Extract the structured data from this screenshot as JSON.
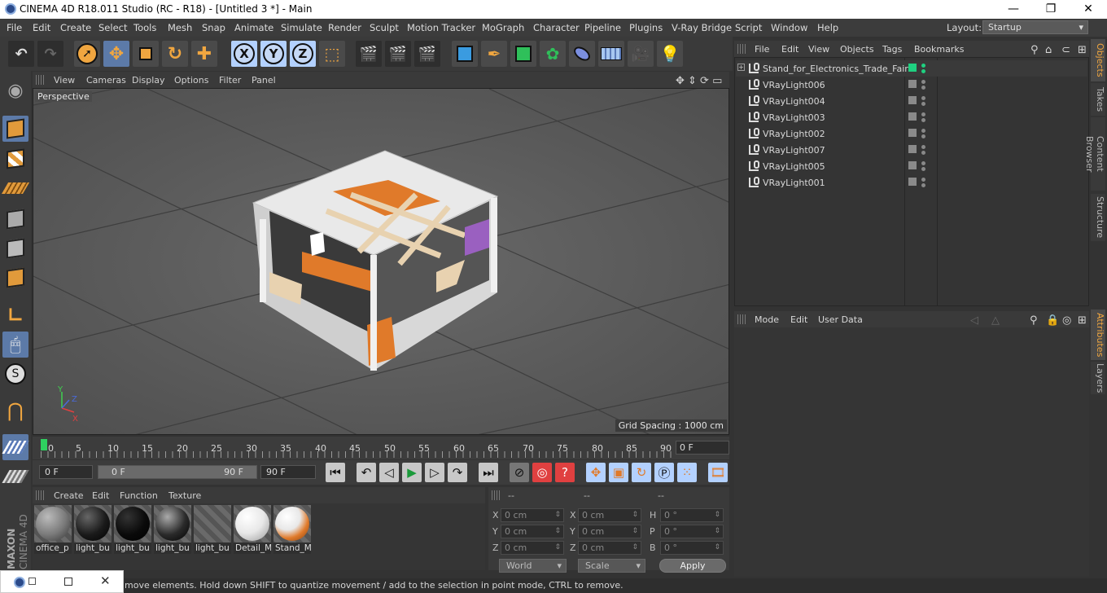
{
  "window": {
    "title": "CINEMA 4D R18.011 Studio (RC - R18) - [Untitled 3 *] - Main",
    "controls": [
      "—",
      "❐",
      "✕"
    ]
  },
  "menubar": {
    "items": [
      "File",
      "Edit",
      "Create",
      "Select",
      "Tools",
      "Mesh",
      "Snap",
      "Animate",
      "Simulate",
      "Render",
      "Sculpt",
      "Motion Tracker",
      "MoGraph",
      "Character",
      "Pipeline",
      "Plugins",
      "V-Ray Bridge",
      "Script",
      "Window",
      "Help"
    ],
    "layout_label": "Layout:",
    "layout_value": "Startup"
  },
  "toolbar": {
    "axis_x": "X",
    "axis_y": "Y",
    "axis_z": "Z"
  },
  "viewport": {
    "menu": [
      "View",
      "Cameras",
      "Display",
      "Options",
      "Filter",
      "Panel"
    ],
    "camera_label": "Perspective",
    "grid_spacing": "Grid Spacing : 1000 cm",
    "axis_labels": {
      "x": "X",
      "y": "Y",
      "z": "Z"
    }
  },
  "timeline": {
    "ticks": [
      "0",
      "5",
      "10",
      "15",
      "20",
      "25",
      "30",
      "35",
      "40",
      "45",
      "50",
      "55",
      "60",
      "65",
      "70",
      "75",
      "80",
      "85",
      "90"
    ],
    "current_frame": "0 F",
    "start_field": "0 F",
    "range_start": "0 F",
    "range_end": "90 F",
    "end_field": "90 F"
  },
  "materials": {
    "menu": [
      "Create",
      "Edit",
      "Function",
      "Texture"
    ],
    "items": [
      {
        "label": "office_p",
        "color": "#7a7a7a"
      },
      {
        "label": "light_bu",
        "color": "#1a1a1a"
      },
      {
        "label": "light_bu",
        "color": "#0a0a0a"
      },
      {
        "label": "light_bu",
        "color": "#2a2a2a"
      },
      {
        "label": "light_bu",
        "color": ""
      },
      {
        "label": "Detail_M",
        "color": "#e8e8e8"
      },
      {
        "label": "Stand_M",
        "color": "#e07a2a"
      }
    ]
  },
  "coordinates": {
    "headers": [
      "--",
      "--",
      "--"
    ],
    "rows": [
      {
        "l1": "X",
        "v1": "0 cm",
        "l2": "X",
        "v2": "0 cm",
        "l3": "H",
        "v3": "0 °"
      },
      {
        "l1": "Y",
        "v1": "0 cm",
        "l2": "Y",
        "v2": "0 cm",
        "l3": "P",
        "v3": "0 °"
      },
      {
        "l1": "Z",
        "v1": "0 cm",
        "l2": "Z",
        "v2": "0 cm",
        "l3": "B",
        "v3": "0 °"
      }
    ],
    "space": "World",
    "mode": "Scale",
    "apply": "Apply"
  },
  "object_manager": {
    "menu": [
      "File",
      "Edit",
      "View",
      "Objects",
      "Tags",
      "Bookmarks"
    ],
    "objects": [
      {
        "name": "Stand_for_Electronics_Trade_Fair",
        "active": true
      },
      {
        "name": "VRayLight006",
        "active": false
      },
      {
        "name": "VRayLight004",
        "active": false
      },
      {
        "name": "VRayLight003",
        "active": false
      },
      {
        "name": "VRayLight002",
        "active": false
      },
      {
        "name": "VRayLight007",
        "active": false
      },
      {
        "name": "VRayLight005",
        "active": false
      },
      {
        "name": "VRayLight001",
        "active": false
      }
    ]
  },
  "attribute_manager": {
    "menu": [
      "Mode",
      "Edit",
      "User Data"
    ]
  },
  "side_tabs": {
    "top": [
      "Objects",
      "Takes",
      "Content Browser",
      "Structure"
    ],
    "bottom": [
      "Attributes",
      "Layers"
    ]
  },
  "status": {
    "text": "move elements. Hold down SHIFT to quantize movement / add to the selection in point mode, CTRL to remove."
  },
  "branding": {
    "maxon": "MAXON",
    "cinema": "CINEMA 4D"
  }
}
